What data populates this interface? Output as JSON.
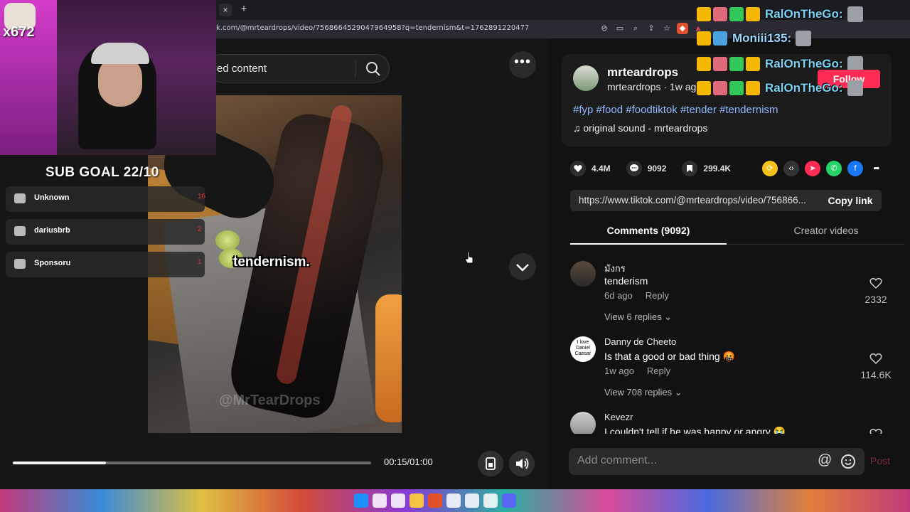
{
  "browser": {
    "url": "k.com/@mrteardrops/video/7568664529047964958?q=tendernism&t=1762891220477",
    "tab_close": "×",
    "new_tab": "+"
  },
  "search": {
    "text": "ed content"
  },
  "video": {
    "caption": "tendernism.",
    "watermark": "@MrTearDrops",
    "time": "00:15/01:00",
    "progress": 0.26
  },
  "author": {
    "name": "mrteardrops",
    "sub": "mrteardrops · 1w ago",
    "hashtags": "#fyp #food #foodtiktok #tender #tendernism",
    "sound": "♫  original sound - mrteardrops",
    "follow_label": "Follow"
  },
  "stats": {
    "likes": "4.4M",
    "comments": "9092",
    "saves": "299.4K"
  },
  "share": {
    "link": "https://www.tiktok.com/@mrteardrops/video/756866...",
    "copy_label": "Copy link"
  },
  "tabs": {
    "comments": "Comments (9092)",
    "creator": "Creator videos"
  },
  "comments": [
    {
      "name": "มังกร",
      "text": "tenderism",
      "time": "6d ago",
      "reply": "Reply",
      "likes": "2332",
      "replies": "View 6 replies ⌄"
    },
    {
      "name": "Danny de Cheeto",
      "text": "Is that a good or bad thing 🤬",
      "time": "1w ago",
      "reply": "Reply",
      "likes": "114.6K",
      "replies": "View 708 replies ⌄"
    },
    {
      "name": "Kevezr",
      "text": "I couldn't tell if he was happy or angry 😭",
      "time": "",
      "reply": "",
      "likes": "",
      "replies": ""
    }
  ],
  "comment_avatar_text": "I love Daniel Caesar",
  "comment_input": {
    "placeholder": "Add comment...",
    "at": "@",
    "post": "Post"
  },
  "overlay": {
    "viewers": "x672",
    "sub_goal": "SUB GOAL 22/10",
    "sub_items": [
      {
        "name": "Unknown",
        "num": "16"
      },
      {
        "name": "dariusbrb",
        "num": "2"
      },
      {
        "name": "Sponsoru",
        "num": "1"
      }
    ],
    "chat": [
      {
        "name": "RalOnTheGo:",
        "color": "#7bd3f5"
      },
      {
        "name": "Moniii135:",
        "color": "#9ad8ff"
      },
      {
        "name": "RalOnTheGo:",
        "color": "#7bd3f5"
      },
      {
        "name": "RalOnTheGo:",
        "color": "#7bd3f5"
      }
    ]
  },
  "colors": {
    "tiktok_red": "#fe2c55",
    "hashtag_blue": "#8fb8ff"
  }
}
